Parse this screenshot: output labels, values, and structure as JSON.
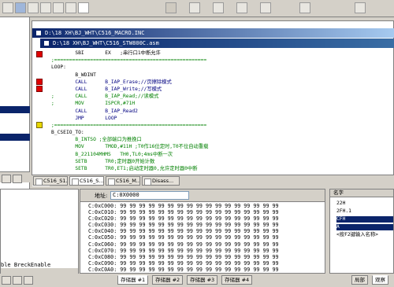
{
  "toolbar": {
    "buttons": [
      "undo-icon",
      "redo-icon",
      "copy-icon",
      "paste-icon",
      "find-icon",
      "settings-icon",
      "open-icon",
      "save-icon",
      "build-icon",
      "stop-icon",
      "run-icon",
      "step-icon",
      "stepover-icon",
      "reset-icon"
    ]
  },
  "editor": {
    "outer_title": "D:\\18 XH\\BJ_WHT\\C516_MACRO.INC",
    "inner_title": "D:\\18 XH\\BJ_WHT\\C516_STW800C.asm",
    "lines": [
      "        SBI       EX   ;串行口1中断允许",
      ";===================================================",
      "LOOP:",
      "        B_WDINT",
      "        CALL      B_IAP_Erase;//页擦除模式",
      "        CALL      B_IAP_Write;//写模式",
      ";       CALL      B_IAP_Read;//读模式",
      ";       MOV       ISPCR,#71H",
      "        CALL      B_IAP_Read2",
      "        JMP       LOOP",
      ";===================================================",
      "B_CSEIO_TO:",
      "        B_INTSO ;全部端口为推挽口",
      "        MOV       TMOD,#11H ;T0作16位定时,T0不位自动重载",
      "        B_221104MHMS   TH0,TL0;4ms中断一次",
      "        SETB      TR0;定时器0开始计数",
      "        SETB      TR0,ET1;启动定时器0,允许定时器0中断"
    ]
  },
  "doc_tabs": [
    "C516_S1...",
    "C516_S...",
    "C516_M...",
    "Disass..."
  ],
  "left_pane": {
    "bottom_text": "ble BreckEnable"
  },
  "memory": {
    "addr_label": "地址:",
    "addr_value": "C:0X0000",
    "rows": [
      "C:0xC000: 99 99 99 99 99 99 99 99 99 99 99 99 99 99 99 99 99",
      "C:0xC010: 99 99 99 99 99 99 99 99 99 99 99 99 99 99 99 99 99",
      "C:0xC020: 99 99 99 99 99 99 99 99 99 99 99 99 99 99 99 99 99",
      "C:0xC030: 99 99 99 99 99 99 99 99 99 99 99 99 99 99 99 99 99",
      "C:0xC040: 99 99 99 99 99 99 99 99 99 99 99 99 99 99 99 99 99",
      "C:0xC050: 99 99 99 99 99 99 99 99 99 99 99 99 99 99 99 99 99",
      "C:0xC060: 99 99 99 99 99 99 99 99 99 99 99 99 99 99 99 99 99",
      "C:0xC070: 99 99 99 99 99 99 99 99 99 99 99 99 99 99 99 99 99",
      "C:0xC080: 99 99 99 99 99 99 99 99 99 99 99 99 99 99 99 99 99",
      "C:0xC090: 99 99 99 99 99 99 99 99 99 99 99 99 99 99 99 99 99",
      "C:0xC0A0: 99 99 99 99 99 99 99 99 99 99 99 99 99 99 99 99 99"
    ],
    "tabs": [
      "存储器 #1",
      "存储器 #2",
      "存储器 #3",
      "存储器 #4"
    ]
  },
  "watch": {
    "header": "名字",
    "rows": [
      "22H",
      "2FH.1",
      "CFH",
      "A",
      "<按F2键输入名称>"
    ],
    "tabs": [
      "局部",
      "观察"
    ]
  }
}
